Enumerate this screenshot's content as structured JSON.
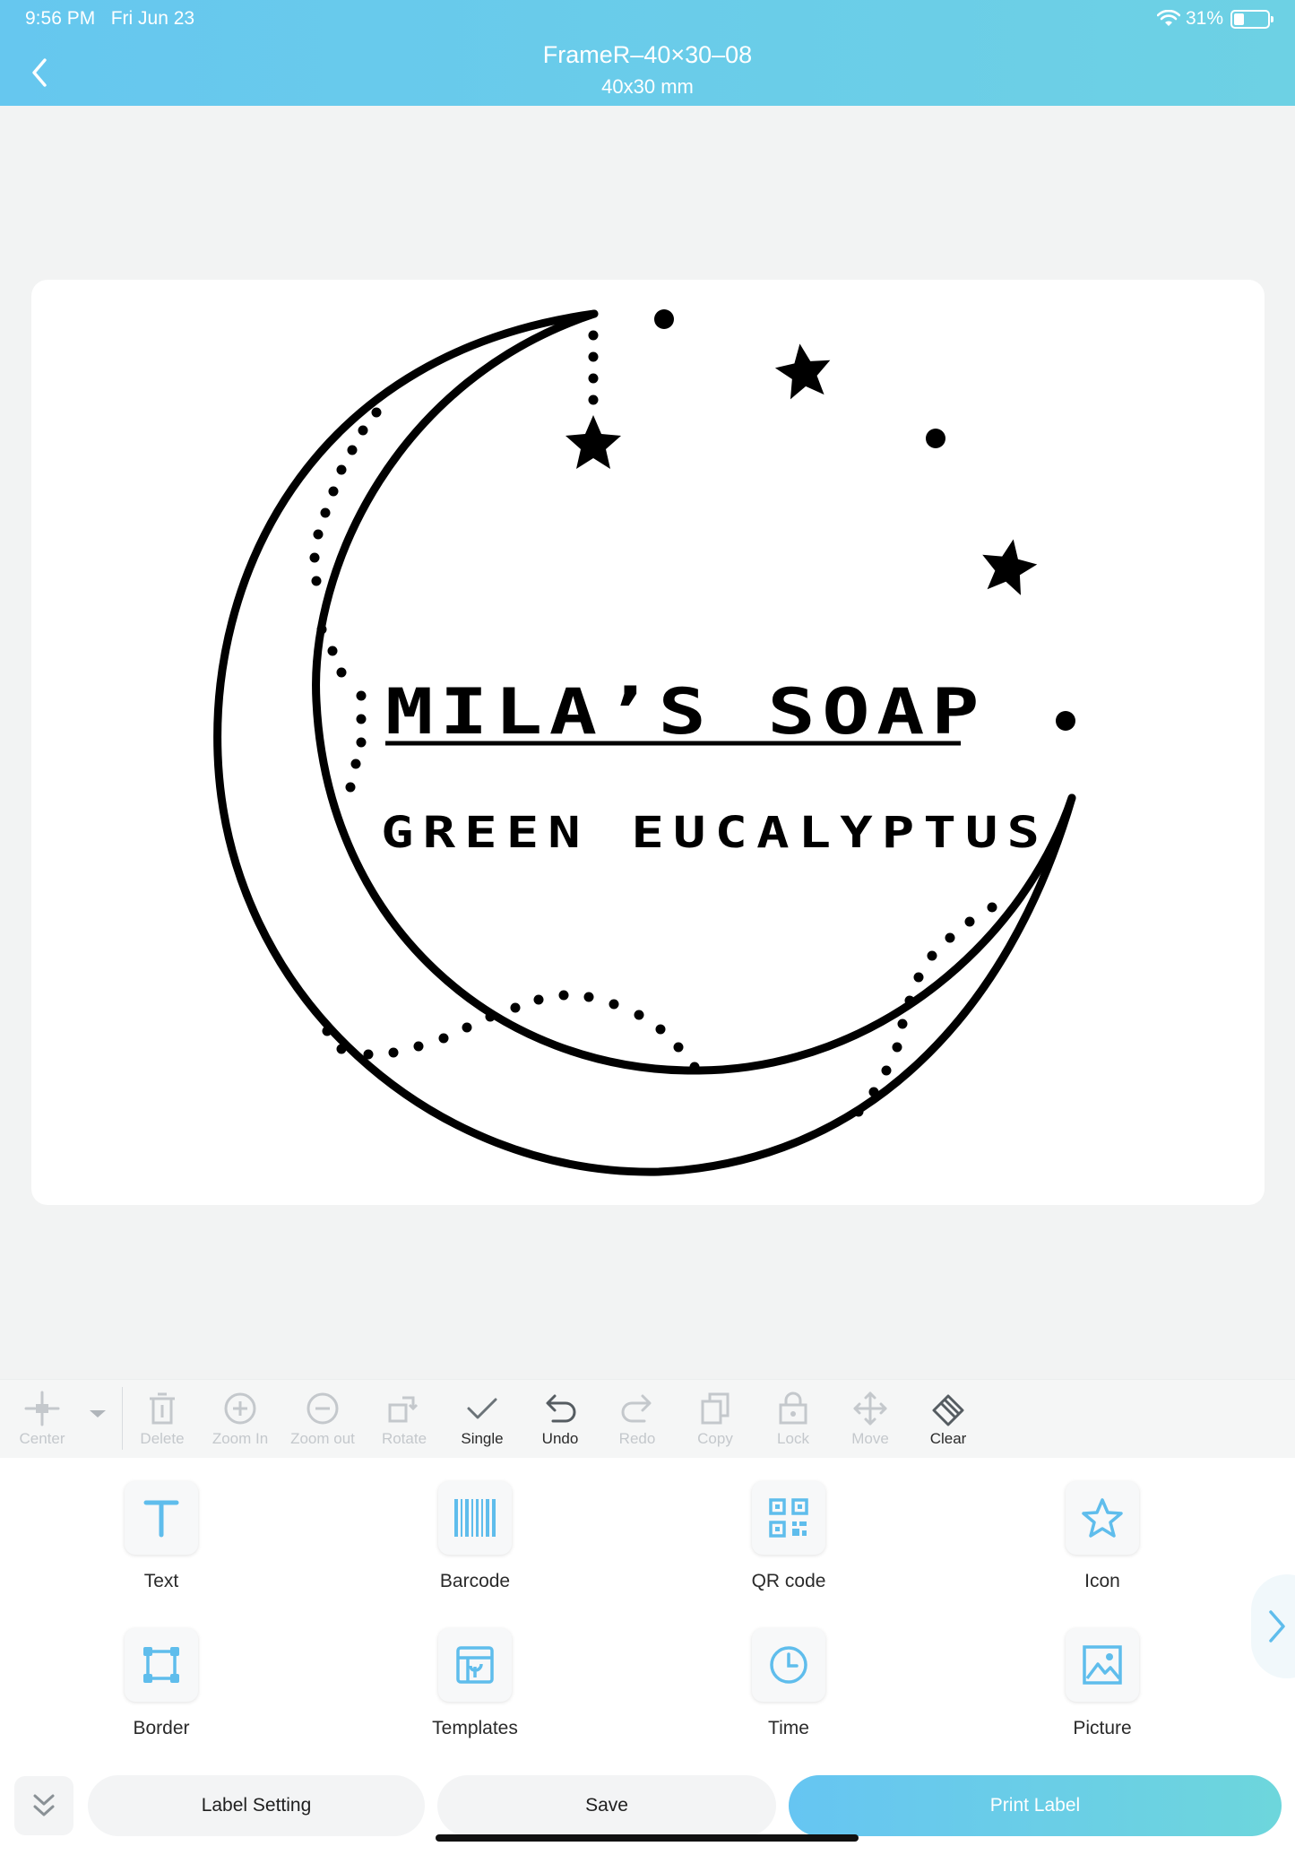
{
  "status_bar": {
    "time": "9:56 PM",
    "date": "Fri Jun 23",
    "battery": "31%",
    "battery_level": 0.31
  },
  "header": {
    "title": "FrameR–40×30–08",
    "subtitle": "40x30 mm",
    "back_icon": "chevron-left-icon"
  },
  "label": {
    "line1": "MILA’S SOAP",
    "line2": "GREEN EUCALYPTUS",
    "art": "crescent moon with stars and dotted trails"
  },
  "toolbar": {
    "items": [
      {
        "label": "Center",
        "icon": "align-center-icon",
        "enabled": false
      },
      {
        "label": "Delete",
        "icon": "trash-icon",
        "enabled": false
      },
      {
        "label": "Zoom In",
        "icon": "zoom-in-icon",
        "enabled": false
      },
      {
        "label": "Zoom out",
        "icon": "zoom-out-icon",
        "enabled": false
      },
      {
        "label": "Rotate",
        "icon": "rotate-icon",
        "enabled": false
      },
      {
        "label": "Single",
        "icon": "check-icon",
        "enabled": true
      },
      {
        "label": "Undo",
        "icon": "undo-icon",
        "enabled": true
      },
      {
        "label": "Redo",
        "icon": "redo-icon",
        "enabled": false
      },
      {
        "label": "Copy",
        "icon": "copy-icon",
        "enabled": false
      },
      {
        "label": "Lock",
        "icon": "lock-icon",
        "enabled": false
      },
      {
        "label": "Move",
        "icon": "move-icon",
        "enabled": false
      },
      {
        "label": "Clear",
        "icon": "eraser-icon",
        "enabled": true
      }
    ]
  },
  "elements": [
    {
      "label": "Text",
      "icon": "text-icon"
    },
    {
      "label": "Barcode",
      "icon": "barcode-icon"
    },
    {
      "label": "QR code",
      "icon": "qr-code-icon"
    },
    {
      "label": "Icon",
      "icon": "star-icon"
    },
    {
      "label": "Border",
      "icon": "border-icon"
    },
    {
      "label": "Templates",
      "icon": "templates-icon"
    },
    {
      "label": "Time",
      "icon": "clock-icon"
    },
    {
      "label": "Picture",
      "icon": "picture-icon"
    }
  ],
  "bottom": {
    "label_setting": "Label Setting",
    "save": "Save",
    "print": "Print Label"
  },
  "colors": {
    "accent": "#66c7ef",
    "icon_blue": "#5fbdec",
    "disabled": "#c4c8cc"
  }
}
